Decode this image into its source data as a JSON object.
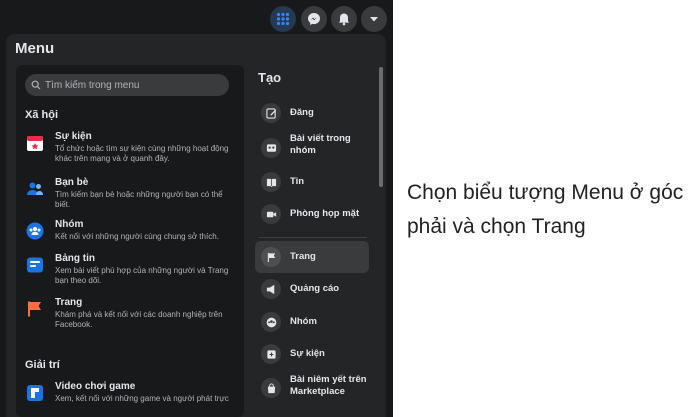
{
  "menu": {
    "title": "Menu"
  },
  "search": {
    "placeholder": "Tìm kiếm trong menu"
  },
  "social": {
    "title": "Xã hội",
    "items": [
      {
        "title": "Sự kiện",
        "desc": "Tổ chức hoặc tìm sự kiện cùng những hoạt động khác trên mạng và ở quanh đây.",
        "icon": "calendar-icon"
      },
      {
        "title": "Bạn bè",
        "desc": "Tìm kiếm bạn bè hoặc những người bạn có thể biết.",
        "icon": "friends-icon"
      },
      {
        "title": "Nhóm",
        "desc": "Kết nối với những người cùng chung sở thích.",
        "icon": "groups-icon"
      },
      {
        "title": "Bảng tin",
        "desc": "Xem bài viết phù hợp của những người và Trang bạn theo dõi.",
        "icon": "news-feed-icon"
      },
      {
        "title": "Trang",
        "desc": "Khám phá và kết nối với các doanh nghiệp trên Facebook.",
        "icon": "flag-icon"
      }
    ]
  },
  "entertainment": {
    "title": "Giải trí",
    "items": [
      {
        "title": "Video chơi game",
        "desc": "Xem, kết nối với những game và người phát trực",
        "icon": "gaming-icon"
      }
    ]
  },
  "create": {
    "title": "Tạo",
    "items": [
      {
        "label": "Đăng",
        "icon": "pencil-icon"
      },
      {
        "label": "Bài viết trong nhóm",
        "icon": "group-post-icon"
      },
      {
        "label": "Tin",
        "icon": "book-icon"
      },
      {
        "label": "Phòng họp mặt",
        "icon": "video-icon"
      },
      {
        "label": "Trang",
        "icon": "flag-icon"
      },
      {
        "label": "Quảng cáo",
        "icon": "megaphone-icon"
      },
      {
        "label": "Nhóm",
        "icon": "group-icon"
      },
      {
        "label": "Sự kiện",
        "icon": "event-icon"
      },
      {
        "label": "Bài niêm yết trên Marketplace",
        "icon": "shopping-bag-icon"
      }
    ]
  },
  "topbar": {
    "icons": [
      "menu-grid-icon",
      "messenger-icon",
      "notifications-icon",
      "dropdown-icon"
    ]
  },
  "caption": "Chọn biểu tượng Menu ở góc phải và chọn Trang",
  "colors": {
    "accent": "#2d88ff",
    "panel": "#242526",
    "background": "#18191a",
    "text": "#e4e6eb"
  }
}
